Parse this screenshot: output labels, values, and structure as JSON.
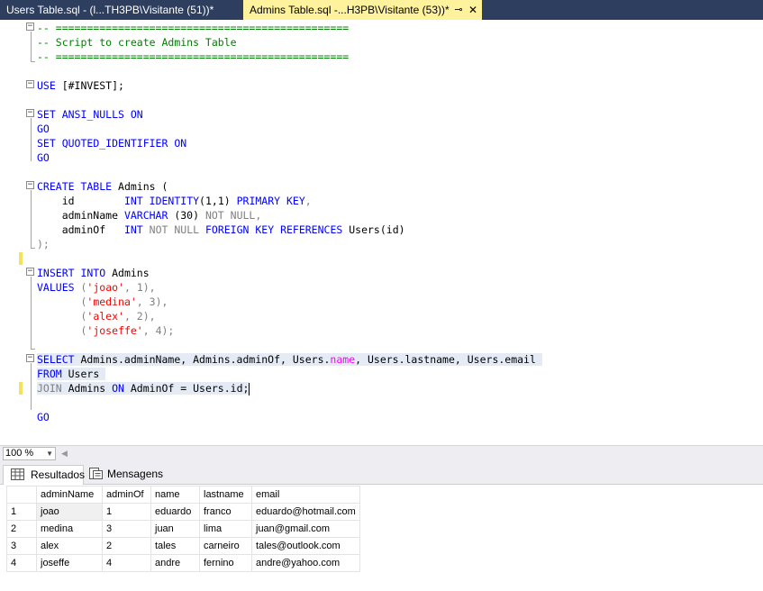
{
  "tabs": [
    {
      "label": "Users Table.sql - (l...TH3PB\\Visitante (51))*",
      "active": false
    },
    {
      "label": "Admins Table.sql -...H3PB\\Visitante (53))*",
      "active": true
    }
  ],
  "tab_icons": {
    "pin": "⊸",
    "close": "✕"
  },
  "editor": {
    "comment_rule": "-- ===============================================",
    "comment_title": "-- Script to create Admins Table",
    "use_kw": "USE",
    "use_db": " [#INVEST];",
    "set_kw": "SET",
    "ansi": " ANSI_NULLS ",
    "on_kw": "ON",
    "go_kw": "GO",
    "quoted": " QUOTED_IDENTIFIER ",
    "create_kw": "CREATE TABLE",
    "admins_open": " Admins (",
    "id_col": "    id        ",
    "int_kw": "INT",
    "identity_kw": "IDENTITY",
    "identity_args": "(1,1) ",
    "pk_kw": "PRIMARY KEY",
    "comma": ",",
    "adminname_col": "    adminName ",
    "varchar_kw": "VARCHAR",
    "varchar_args": " (30) ",
    "not_null": "NOT NULL",
    "adminof_col": "    adminOf   ",
    "fk_kw": "FOREIGN KEY REFERENCES",
    "users_ref": " Users(id)",
    "close_paren": ");",
    "insert_kw": "INSERT INTO",
    "admins_tbl": " Admins",
    "values_kw": "VALUES",
    "v1_str": "'joao'",
    "v1_num": ", 1),",
    "v2_str": "'medina'",
    "v2_num": ", 3),",
    "v3_str": "'alex'",
    "v3_num": ", 2),",
    "v4_str": "'joseffe'",
    "v4_num": ", 4);",
    "select_kw": "SELECT",
    "select_cols1": " Admins.adminName, Admins.adminOf, Users.",
    "name_kw": "name",
    "select_cols2": ", Users.lastname, Users.email ",
    "from_kw": "FROM",
    "from_tbl": " Users ",
    "join_kw": "JOIN",
    "join_tbl": " Admins ",
    "join_cond": " AdminOf = Users.id;"
  },
  "zoom": {
    "value": "100 %"
  },
  "results_tabs": [
    {
      "label": "Resultados",
      "icon": "grid-icon"
    },
    {
      "label": "Mensagens",
      "icon": "messages-icon"
    }
  ],
  "results": {
    "columns": [
      "adminName",
      "adminOf",
      "name",
      "lastname",
      "email"
    ],
    "rows": [
      [
        "1",
        "joao",
        "1",
        "eduardo",
        "franco",
        "eduardo@hotmail.com"
      ],
      [
        "2",
        "medina",
        "3",
        "juan",
        "lima",
        "juan@gmail.com"
      ],
      [
        "3",
        "alex",
        "2",
        "tales",
        "carneiro",
        "tales@outlook.com"
      ],
      [
        "4",
        "joseffe",
        "4",
        "andre",
        "fernino",
        "andre@yahoo.com"
      ]
    ]
  }
}
